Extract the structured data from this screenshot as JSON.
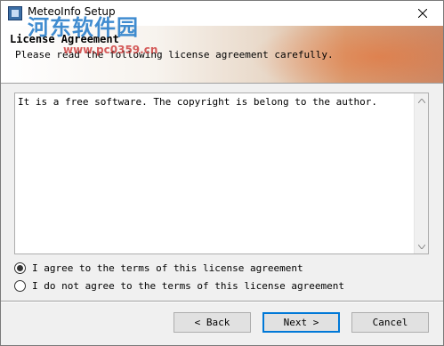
{
  "window": {
    "title": "MeteoInfo Setup",
    "close_icon": "close-icon"
  },
  "watermark": {
    "text": "河东软件园",
    "url": "www.pc0359.cn"
  },
  "header": {
    "title": "License Agreement",
    "subtitle": "Please read the following license agreement carefully."
  },
  "license": {
    "text": "It is a free software. The copyright is belong to the author."
  },
  "options": [
    {
      "label": "I agree to the terms of this license agreement",
      "checked": true
    },
    {
      "label": "I do not agree to the terms of this license agreement",
      "checked": false
    }
  ],
  "buttons": {
    "back": "< Back",
    "next": "Next >",
    "cancel": "Cancel"
  }
}
